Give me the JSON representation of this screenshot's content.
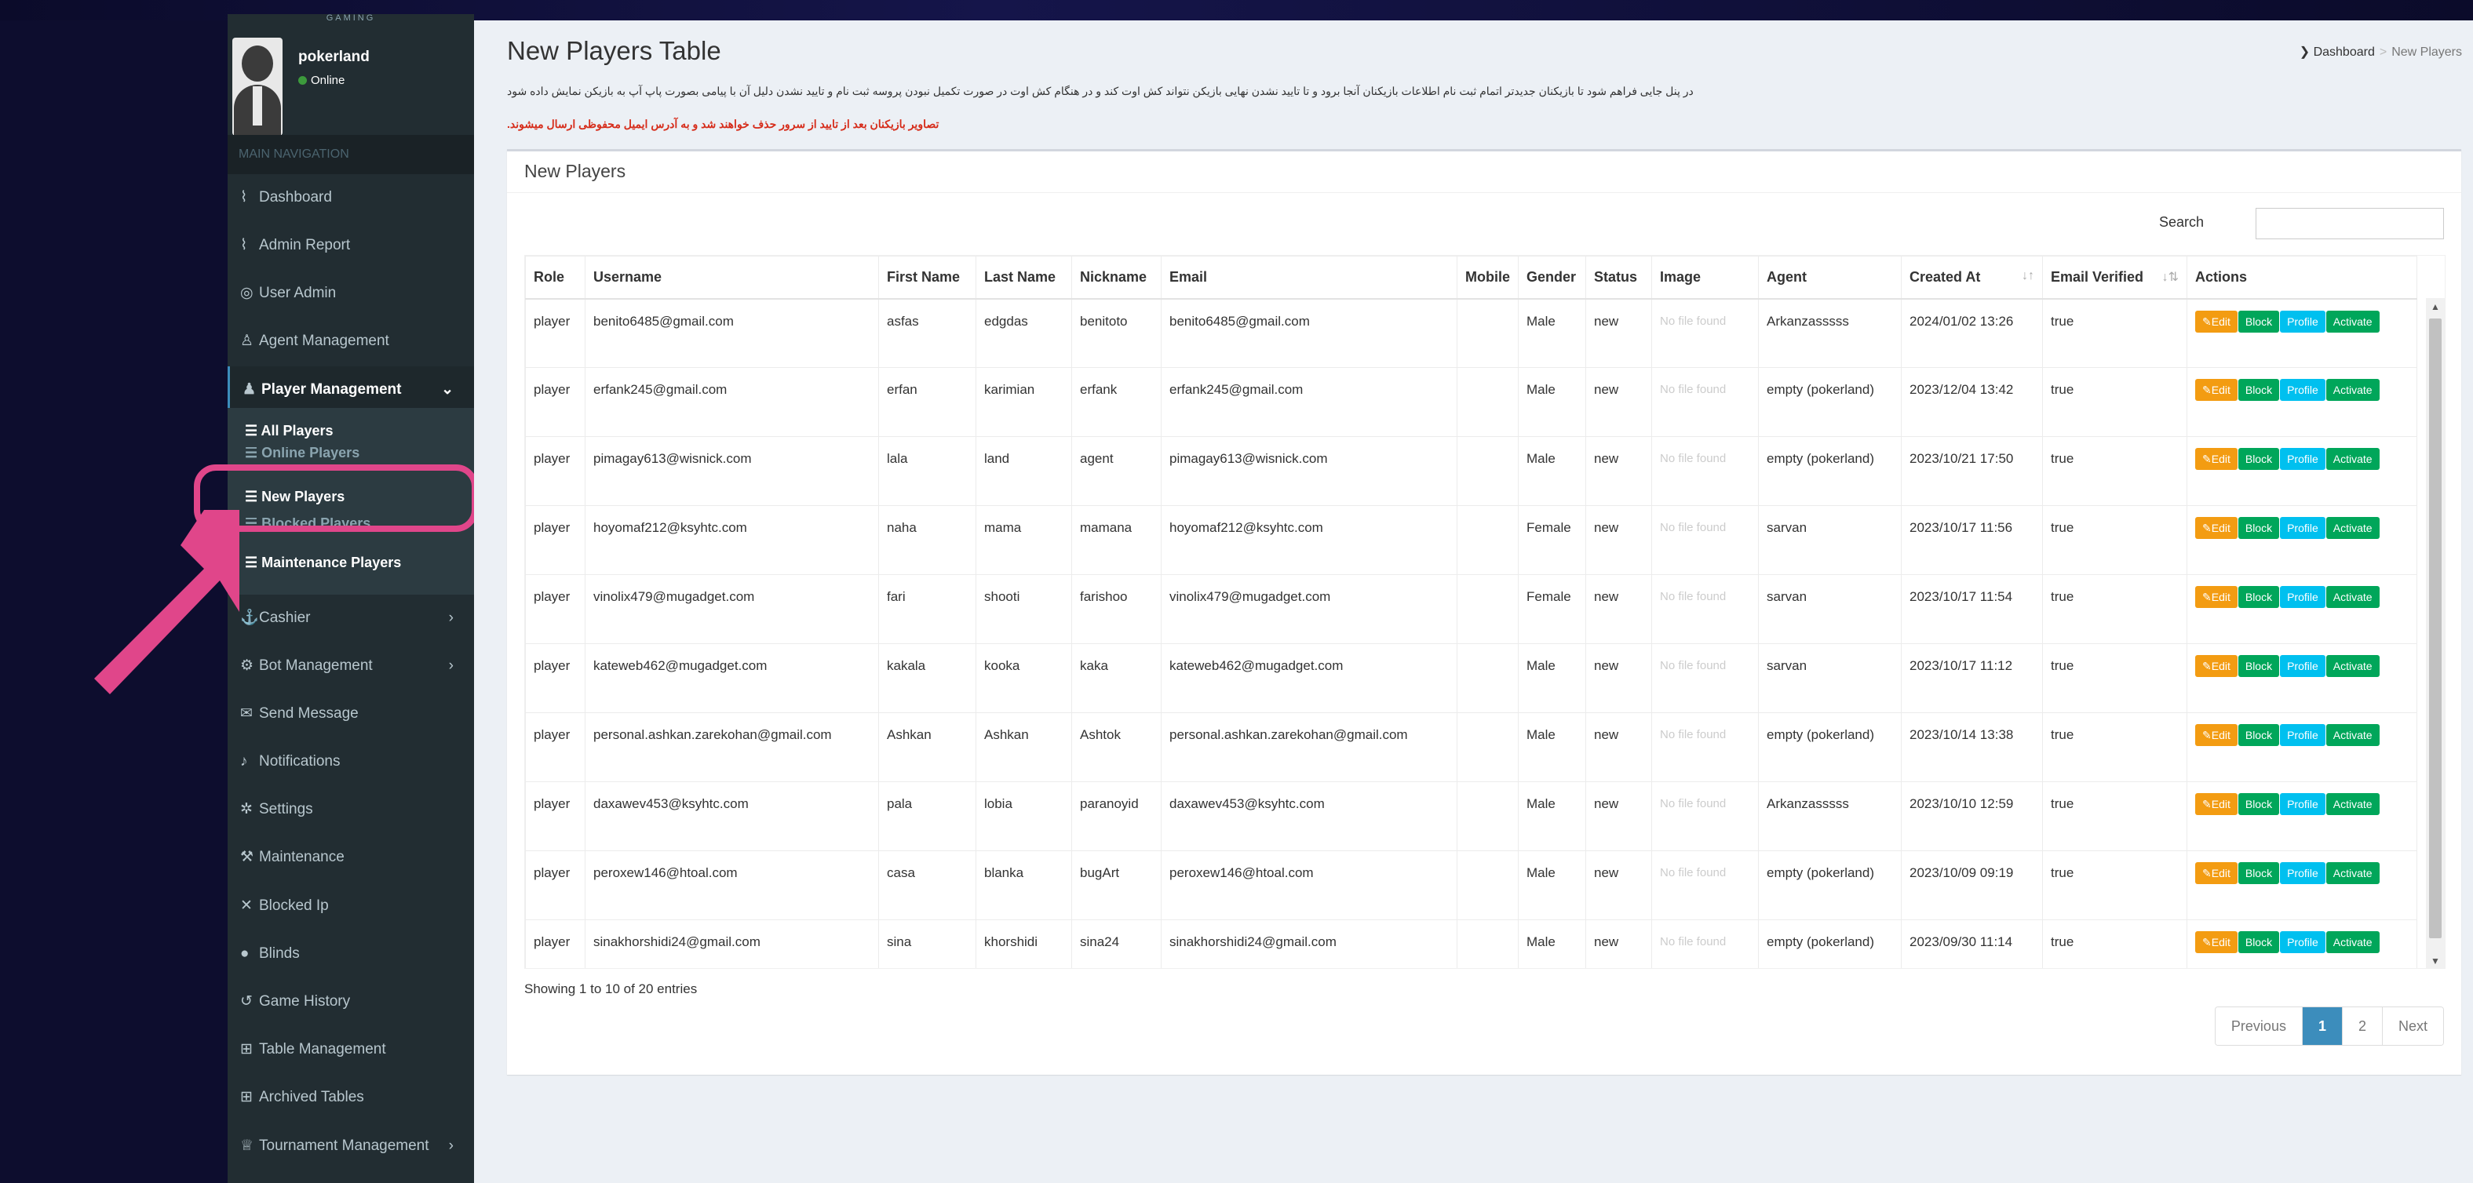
{
  "brand_top": "GAMING",
  "user": {
    "name": "pokerland",
    "status": "Online"
  },
  "nav_header": "MAIN NAVIGATION",
  "nav": {
    "dashboard": "Dashboard",
    "admin_report": "Admin Report",
    "user_admin": "User Admin",
    "agent_management": "Agent Management",
    "player_management": "Player Management",
    "all_players": "All Players",
    "online_players": "Online Players",
    "new_players": "New Players",
    "blocked_players": "Blocked Players",
    "maintenance_players": "Maintenance Players",
    "cashier": "Cashier",
    "bot_management": "Bot Management",
    "send_message": "Send Message",
    "notifications": "Notifications",
    "settings": "Settings",
    "maintenance": "Maintenance",
    "blocked_ip": "Blocked Ip",
    "blinds": "Blinds",
    "game_history": "Game History",
    "table_management": "Table Management",
    "archived_tables": "Archived Tables",
    "tournament_management": "Tournament Management"
  },
  "page": {
    "title": "New Players Table",
    "breadcrumb_home": "Dashboard",
    "breadcrumb_current": "New Players",
    "note": "در پنل جایی فراهم شود تا بازیکنان جدیدتر اتمام ثبت نام اطلاعات بازیکنان آنجا برود و تا تایید نشدن نهایی بازیکن نتواند کش اوت کند و در هنگام کش اوت در صورت تکمیل نبودن پروسه ثبت نام و تایید نشدن دلیل آن با پیامی بصورت پاپ آپ به بازیکن نمایش داده شود",
    "note_red": "تصاویر بازیکنان بعد از تایید از سرور حذف خواهند شد و به آدرس ایمیل محفوظی ارسال میشوند."
  },
  "box": {
    "title": "New Players",
    "search_label": "Search",
    "columns": [
      "Role",
      "Username",
      "First Name",
      "Last Name",
      "Nickname",
      "Email",
      "Mobile",
      "Gender",
      "Status",
      "Image",
      "Agent",
      "Created At",
      "Email Verified",
      "Actions"
    ],
    "no_file": "No file found",
    "buttons": {
      "edit": "Edit",
      "block": "Block",
      "profile": "Profile",
      "activate": "Activate"
    },
    "rows": [
      {
        "role": "player",
        "username": "benito6485@gmail.com",
        "first": "asfas",
        "last": "edgdas",
        "nick": "benitoto",
        "email": "benito6485@gmail.com",
        "mobile": "",
        "gender": "Male",
        "status": "new",
        "agent": "Arkanzasssss",
        "created": "2024/01/02  13:26",
        "verified": "true"
      },
      {
        "role": "player",
        "username": "erfank245@gmail.com",
        "first": "erfan",
        "last": "karimian",
        "nick": "erfank",
        "email": "erfank245@gmail.com",
        "mobile": "",
        "gender": "Male",
        "status": "new",
        "agent": "empty (pokerland)",
        "created": "2023/12/04  13:42",
        "verified": "true"
      },
      {
        "role": "player",
        "username": "pimagay613@wisnick.com",
        "first": "lala",
        "last": "land",
        "nick": "agent",
        "email": "pimagay613@wisnick.com",
        "mobile": "",
        "gender": "Male",
        "status": "new",
        "agent": "empty (pokerland)",
        "created": "2023/10/21  17:50",
        "verified": "true"
      },
      {
        "role": "player",
        "username": "hoyomaf212@ksyhtc.com",
        "first": "naha",
        "last": "mama",
        "nick": "mamana",
        "email": "hoyomaf212@ksyhtc.com",
        "mobile": "",
        "gender": "Female",
        "status": "new",
        "agent": "sarvan",
        "created": "2023/10/17  11:56",
        "verified": "true"
      },
      {
        "role": "player",
        "username": "vinolix479@mugadget.com",
        "first": "fari",
        "last": "shooti",
        "nick": "farishoo",
        "email": "vinolix479@mugadget.com",
        "mobile": "",
        "gender": "Female",
        "status": "new",
        "agent": "sarvan",
        "created": "2023/10/17  11:54",
        "verified": "true"
      },
      {
        "role": "player",
        "username": "kateweb462@mugadget.com",
        "first": "kakala",
        "last": "kooka",
        "nick": "kaka",
        "email": "kateweb462@mugadget.com",
        "mobile": "",
        "gender": "Male",
        "status": "new",
        "agent": "sarvan",
        "created": "2023/10/17  11:12",
        "verified": "true"
      },
      {
        "role": "player",
        "username": "personal.ashkan.zarekohan@gmail.com",
        "first": "Ashkan",
        "last": "Ashkan",
        "nick": "Ashtok",
        "email": "personal.ashkan.zarekohan@gmail.com",
        "mobile": "",
        "gender": "Male",
        "status": "new",
        "agent": "empty (pokerland)",
        "created": "2023/10/14  13:38",
        "verified": "true"
      },
      {
        "role": "player",
        "username": "daxawev453@ksyhtc.com",
        "first": "pala",
        "last": "lobia",
        "nick": "paranoyid",
        "email": "daxawev453@ksyhtc.com",
        "mobile": "",
        "gender": "Male",
        "status": "new",
        "agent": "Arkanzasssss",
        "created": "2023/10/10  12:59",
        "verified": "true"
      },
      {
        "role": "player",
        "username": "peroxew146@htoal.com",
        "first": "casa",
        "last": "blanka",
        "nick": "bugArt",
        "email": "peroxew146@htoal.com",
        "mobile": "",
        "gender": "Male",
        "status": "new",
        "agent": "empty (pokerland)",
        "created": "2023/10/09  09:19",
        "verified": "true"
      },
      {
        "role": "player",
        "username": "sinakhorshidi24@gmail.com",
        "first": "sina",
        "last": "khorshidi",
        "nick": "sina24",
        "email": "sinakhorshidi24@gmail.com",
        "mobile": "",
        "gender": "Male",
        "status": "new",
        "agent": "empty (pokerland)",
        "created": "2023/09/30  11:14",
        "verified": "true"
      }
    ],
    "showing": "Showing 1 to 10 of 20 entries",
    "pager": {
      "previous": "Previous",
      "page1": "1",
      "page2": "2",
      "next": "Next"
    }
  }
}
